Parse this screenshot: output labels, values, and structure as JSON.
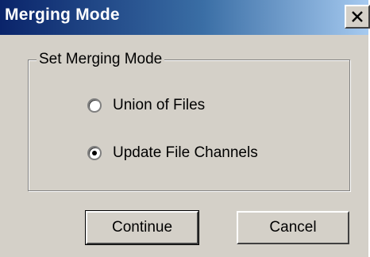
{
  "window": {
    "title": "Merging Mode",
    "close_icon": "close-icon"
  },
  "group": {
    "label": "Set Merging Mode",
    "options": [
      {
        "label": "Union of Files",
        "selected": false
      },
      {
        "label": "Update File Channels",
        "selected": true
      }
    ]
  },
  "buttons": {
    "continue_label": "Continue",
    "cancel_label": "Cancel"
  },
  "colors": {
    "titlebar_start": "#0a246a",
    "titlebar_end": "#a6caf0",
    "dialog_bg": "#d4d0c8"
  }
}
